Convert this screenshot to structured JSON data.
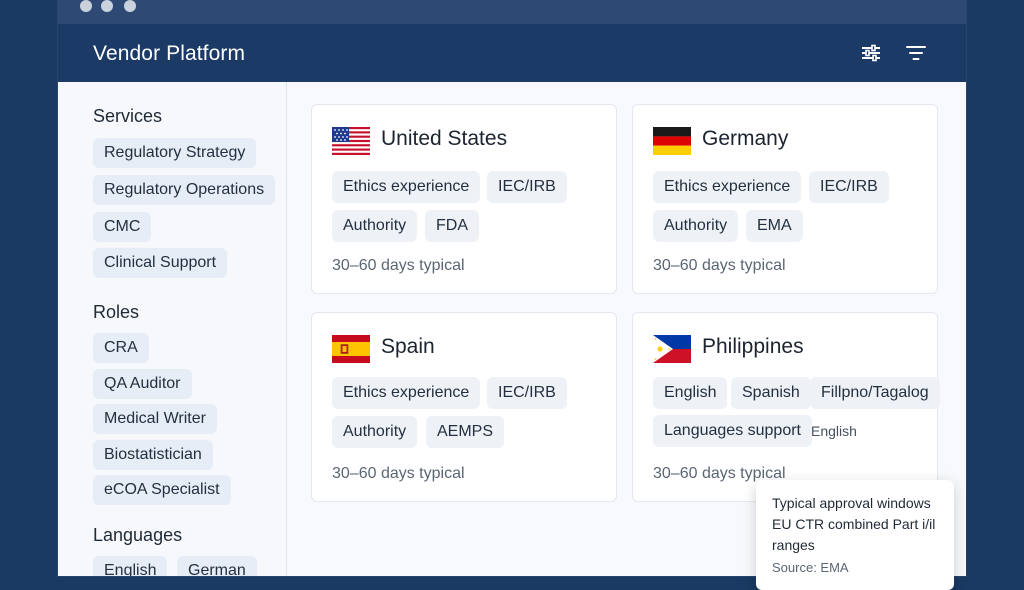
{
  "app": {
    "title": "Vendor Platform"
  },
  "header": {
    "icons": [
      "sliders-icon",
      "filter-icon"
    ]
  },
  "sidebar": {
    "services": {
      "title": "Services",
      "items": [
        "Regulatory Strategy",
        "Regulatory Operations",
        "CMC",
        "Clinical Support"
      ]
    },
    "roles": {
      "title": "Roles",
      "items": [
        "CRA",
        "QA Auditor",
        "Medical Writer",
        "Biostatistician",
        "eCOA Specialist"
      ]
    },
    "languages": {
      "title": "Languages",
      "items": [
        "English",
        "German"
      ]
    }
  },
  "cards": [
    {
      "country": "United States",
      "flag": "us-flag-icon",
      "tags": [
        "Ethics experience",
        "IEC/IRB",
        "Authority",
        "FDA"
      ],
      "typical": "30–60 days typical"
    },
    {
      "country": "Germany",
      "flag": "germany-flag-icon",
      "tags": [
        "Ethics experience",
        "IEC/IRB",
        "Authority",
        "EMA"
      ],
      "typical": "30–60 days typical"
    },
    {
      "country": "Spain",
      "flag": "spain-flag-icon",
      "tags": [
        "Ethics experience",
        "IEC/IRB",
        "Authority",
        "AEMPS"
      ],
      "typical": "30–60 days typical"
    },
    {
      "country": "Philippines",
      "flag": "philippines-flag-icon",
      "tags": [
        "English",
        "Spanish",
        "Fillpno/Tagalog",
        "Languages support"
      ],
      "inline_note": "English",
      "typical": "30–60 days typical"
    }
  ],
  "tooltip": {
    "lines": [
      "Typical approval windows",
      "EU CTR combined Part i/il",
      "ranges"
    ],
    "source": "Source: EMA"
  },
  "colors": {
    "background": "#1a3a63",
    "header": "#1b3a66",
    "titlebar": "#2e4a74",
    "chip": "#e6edf6"
  }
}
